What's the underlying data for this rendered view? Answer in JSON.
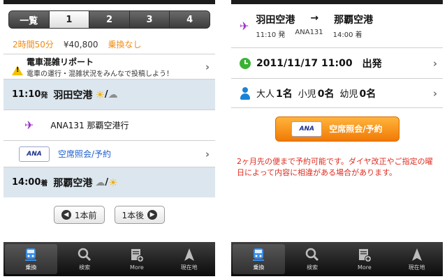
{
  "left": {
    "segments": [
      "一覧",
      "1",
      "2",
      "3",
      "4"
    ],
    "active_segment": "1",
    "summary": {
      "duration": "2時間50分",
      "fare": "¥40,800",
      "transfer": "乗換なし"
    },
    "report": {
      "title": "電車混雑リポート",
      "subtitle": "電車の運行・混雑状況をみんなで投稿しよう！"
    },
    "departure": {
      "time": "11:10",
      "suffix": "発",
      "station": "羽田空港",
      "slash": "/"
    },
    "flight": {
      "label": "ANA131 那覇空港行"
    },
    "booking": {
      "logo": "ANA",
      "link": "空席照会/予約"
    },
    "arrival": {
      "time": "14:00",
      "suffix": "着",
      "station": "那覇空港",
      "slash": "/"
    },
    "nav": {
      "prev": "1本前",
      "next": "1本後"
    }
  },
  "right": {
    "route": {
      "from": "羽田空港",
      "arrow": "→",
      "to": "那覇空港",
      "dep_time": "11:10 発",
      "flight_no": "ANA131",
      "arr_time": "14:00 着"
    },
    "departure": {
      "datetime": "2011/11/17 11:00",
      "label": "出発"
    },
    "passengers": {
      "adult_label": "大人",
      "adult_count": "1名",
      "child_label": "小児",
      "child_count": "0名",
      "infant_label": "幼児",
      "infant_count": "0名"
    },
    "reserve": {
      "logo": "ANA",
      "label": "空席照会/予約"
    },
    "notice": "2ヶ月先の便まで予約可能です。ダイヤ改正やご指定の曜日によって内容に相違がある場合があります。"
  },
  "tabs": [
    {
      "label": "乗換",
      "icon": "train-icon"
    },
    {
      "label": "検索",
      "icon": "search-icon"
    },
    {
      "label": "More",
      "icon": "more-icon"
    },
    {
      "label": "現在地",
      "icon": "location-icon"
    }
  ],
  "colors": {
    "accent_orange": "#f08a10",
    "link_blue": "#1d5fcc",
    "station_row": "#dce6ef",
    "notice_red": "#e02a1e",
    "plane_purple": "#9b2fc9"
  }
}
